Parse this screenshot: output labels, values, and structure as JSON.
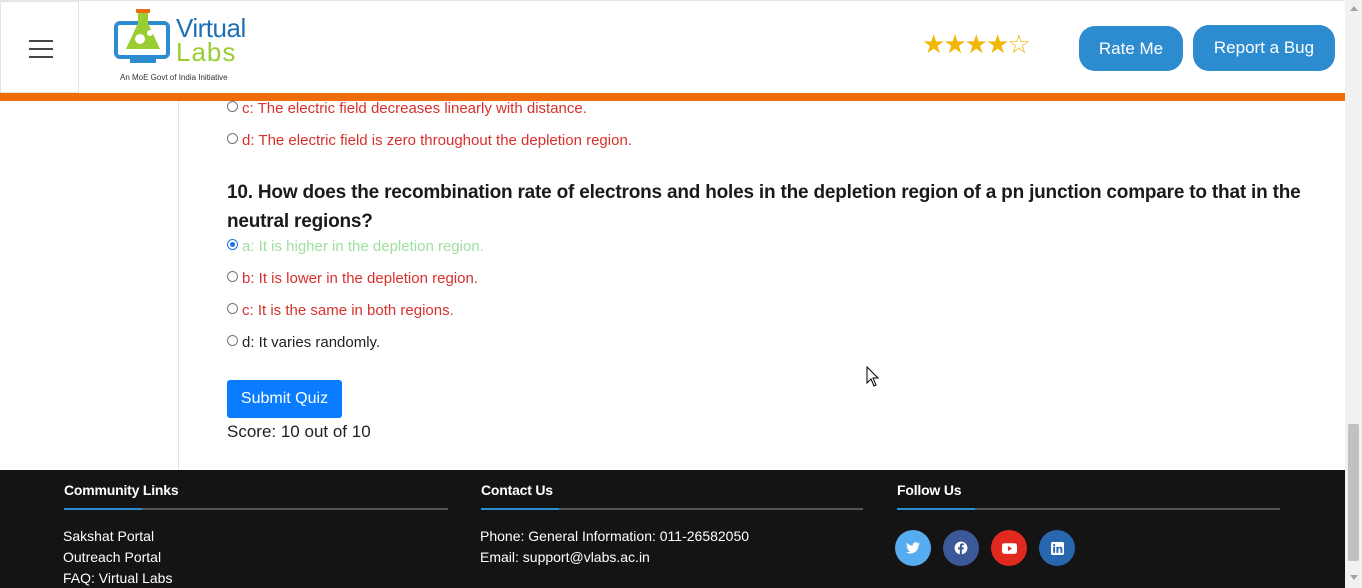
{
  "header": {
    "logo": {
      "brand_line1": "Virtual",
      "brand_line2": "Labs",
      "tagline": "An MoE Govt of India Initiative"
    },
    "rating": {
      "filled": 4,
      "total": 5
    },
    "rate_button": "Rate Me",
    "bug_button": "Report a Bug"
  },
  "quiz": {
    "prev_options": [
      {
        "label": "c: The electric field decreases linearly with distance.",
        "state": "red",
        "checked": false
      },
      {
        "label": "d: The electric field is zero throughout the depletion region.",
        "state": "red",
        "checked": false
      }
    ],
    "question": "10. How does the recombination rate of electrons and holes in the depletion region of a pn junction compare to that in the neutral regions?",
    "options": [
      {
        "label": "a: It is higher in the depletion region.",
        "state": "green",
        "checked": true
      },
      {
        "label": "b: It is lower in the depletion region.",
        "state": "red",
        "checked": false
      },
      {
        "label": "c: It is the same in both regions.",
        "state": "red",
        "checked": false
      },
      {
        "label": "d: It varies randomly.",
        "state": "dark",
        "checked": false
      }
    ],
    "submit_label": "Submit Quiz",
    "score_text": "Score: 10 out of 10"
  },
  "footer": {
    "community": {
      "heading": "Community Links",
      "links": [
        "Sakshat Portal",
        "Outreach Portal",
        "FAQ: Virtual Labs"
      ]
    },
    "contact": {
      "heading": "Contact Us",
      "phone": "Phone: General Information: 011-26582050",
      "email": "Email: support@vlabs.ac.in"
    },
    "follow": {
      "heading": "Follow Us",
      "icons": [
        "twitter-icon",
        "facebook-icon",
        "youtube-icon",
        "linkedin-icon"
      ]
    }
  },
  "colors": {
    "accent_orange": "#f06c0a",
    "primary_blue": "#2d8bd0",
    "submit_blue": "#0a7cff",
    "wrong_red": "#d9302c",
    "correct_green": "#9fdf9f",
    "footer_bg": "#141414"
  }
}
